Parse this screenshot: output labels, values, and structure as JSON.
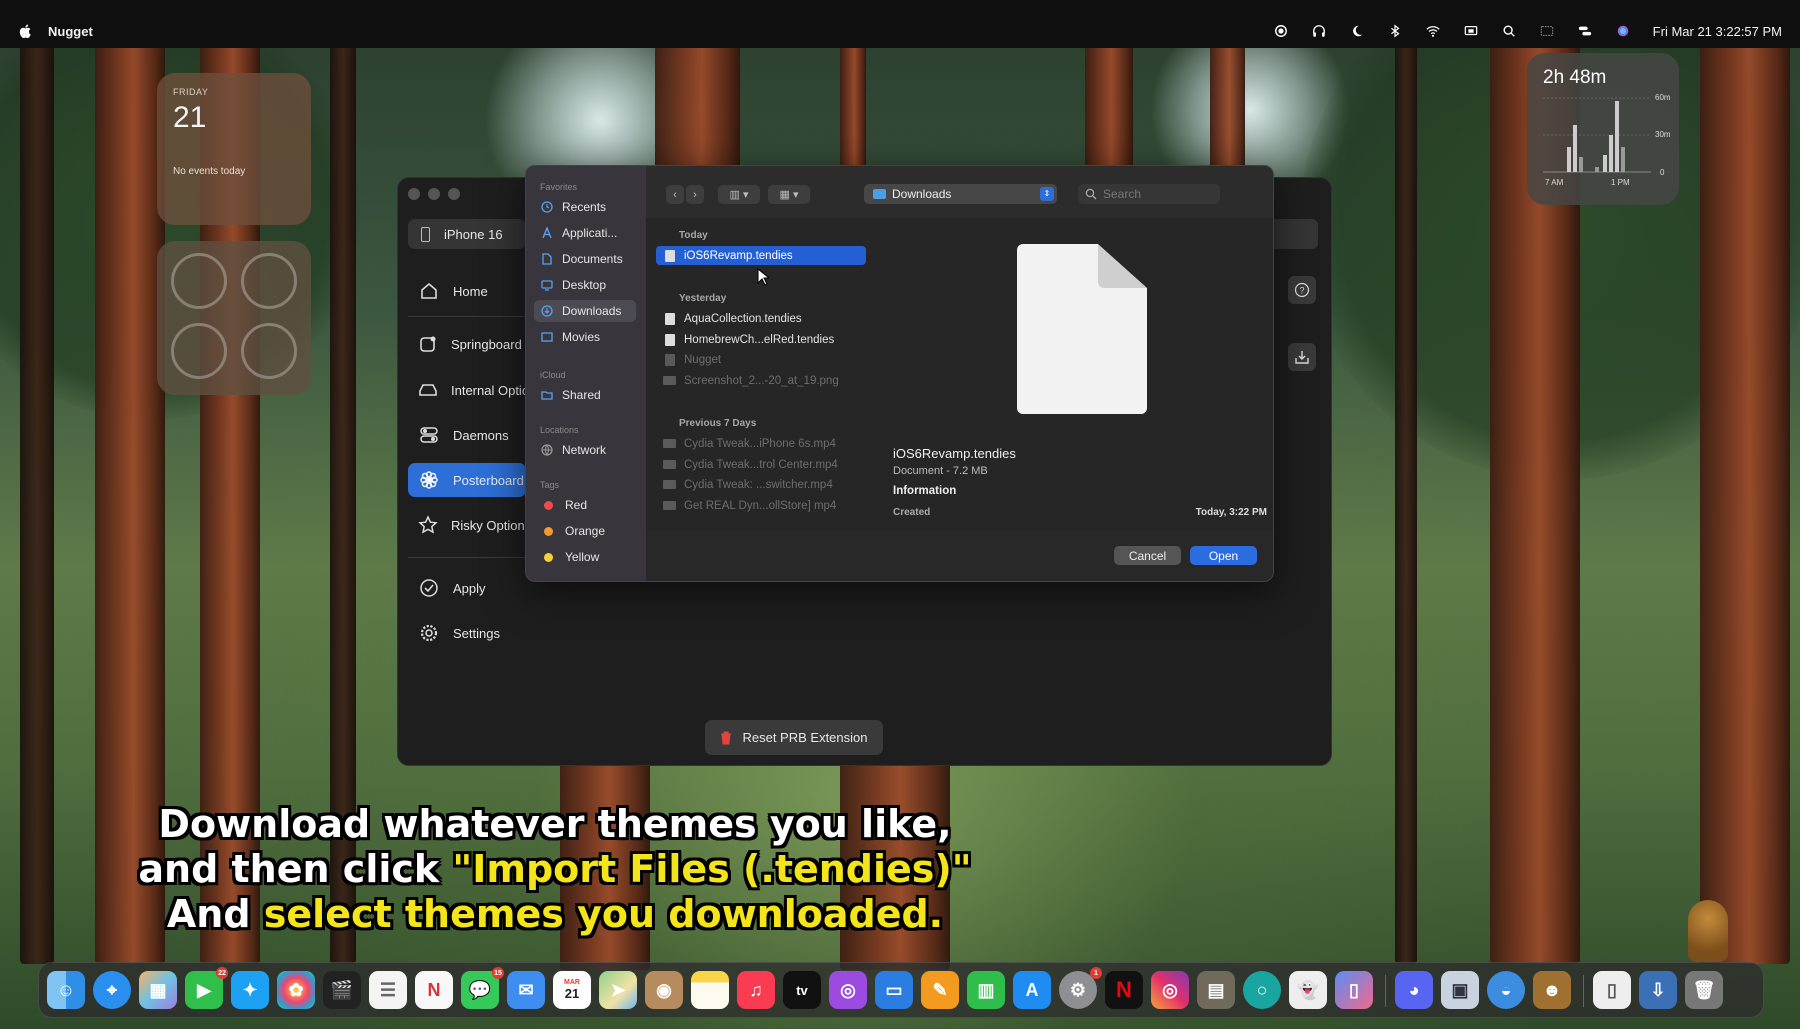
{
  "menubar": {
    "app_name": "Nugget",
    "clock": "Fri Mar 21  3:22:57 PM"
  },
  "widgets": {
    "calendar": {
      "day": "FRIDAY",
      "date": "21",
      "events": "No events today"
    },
    "screen_time": {
      "total": "2h 48m",
      "y_labels": [
        "60m",
        "30m",
        "0"
      ],
      "x_labels": [
        "7 AM",
        "1 PM"
      ]
    }
  },
  "app": {
    "device": "iPhone 16",
    "nav": [
      {
        "label": "Home"
      },
      {
        "label": "Springboard Options"
      },
      {
        "label": "Internal Options"
      },
      {
        "label": "Daemons"
      },
      {
        "label": "Posterboard"
      },
      {
        "label": "Risky Options"
      },
      {
        "label": "Apply"
      },
      {
        "label": "Settings"
      }
    ],
    "reset_button": "Reset PRB Extension"
  },
  "dialog": {
    "sidebar": {
      "favorites_header": "Favorites",
      "favorites": [
        "Recents",
        "Applicati...",
        "Documents",
        "Desktop",
        "Downloads",
        "Movies"
      ],
      "icloud_header": "iCloud",
      "icloud": [
        "Shared"
      ],
      "locations_header": "Locations",
      "locations": [
        "Network"
      ],
      "tags_header": "Tags",
      "tags": [
        "Red",
        "Orange",
        "Yellow"
      ]
    },
    "location": "Downloads",
    "search_placeholder": "Search",
    "groups": {
      "today": "Today",
      "yesterday": "Yesterday",
      "previous": "Previous 7 Days"
    },
    "files_today": [
      "iOS6Revamp.tendies"
    ],
    "files_yesterday": [
      "AquaCollection.tendies",
      "HomebrewCh...elRed.tendies",
      "Nugget",
      "Screenshot_2...-20_at_19.png"
    ],
    "files_previous": [
      "Cydia Tweak...iPhone 6s.mp4",
      "Cydia Tweak...trol Center.mp4",
      "Cydia Tweak:  ...switcher.mp4",
      "Get REAL Dyn...ollStore] mp4"
    ],
    "preview": {
      "name": "iOS6Revamp.tendies",
      "kind": "Document - 7.2 MB",
      "info_header": "Information",
      "created_label": "Created",
      "created_value": "Today, 3:22 PM"
    },
    "cancel": "Cancel",
    "open": "Open"
  },
  "caption": {
    "line1": "Download whatever themes you like,",
    "line2_a": "and then click ",
    "line2_b": "\"Import Files (.tendies)\"",
    "line3_a": "And ",
    "line3_b": "select themes you downloaded."
  },
  "dock": {
    "badges": {
      "facetime": "22",
      "messages": "15",
      "calendar": "21",
      "settings": "1"
    },
    "calendar_month": "MAR",
    "tv_label": "tv"
  },
  "colors": {
    "accent": "#2b6ce0",
    "caption_highlight": "#f3e51a"
  }
}
